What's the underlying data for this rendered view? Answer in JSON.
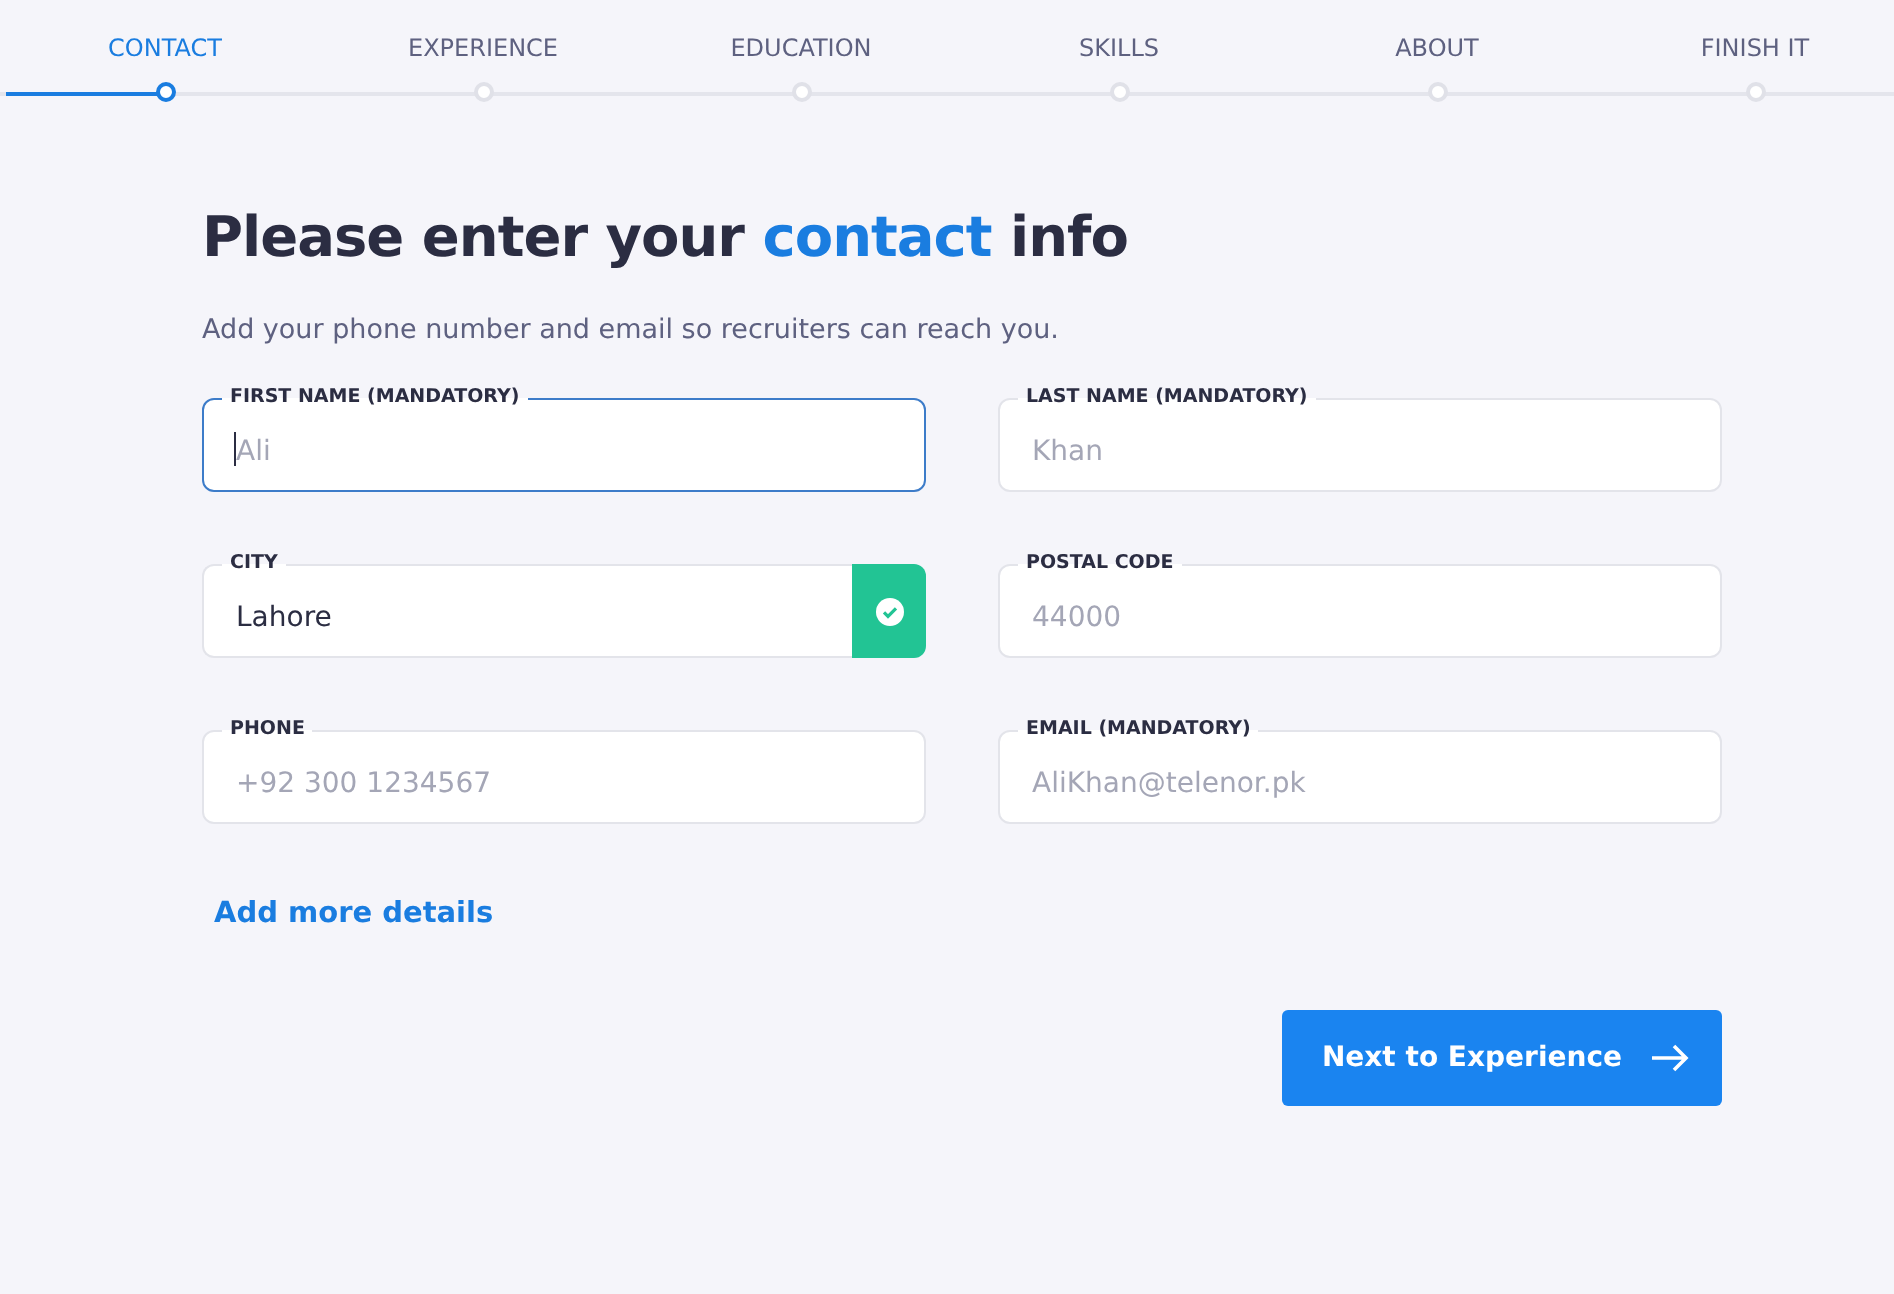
{
  "steps": [
    {
      "label": "CONTACT",
      "selected": true
    },
    {
      "label": "EXPERIENCE",
      "selected": false
    },
    {
      "label": "EDUCATION",
      "selected": false
    },
    {
      "label": "SKILLS",
      "selected": false
    },
    {
      "label": "ABOUT",
      "selected": false
    },
    {
      "label": "FINISH IT",
      "selected": false
    }
  ],
  "heading": {
    "before": "Please enter your ",
    "highlight": "contact",
    "after": " info"
  },
  "subtitle": "Add your phone number and email so recruiters can reach you.",
  "fields": [
    {
      "label": "FIRST NAME (MANDATORY)",
      "placeholder": "Ali",
      "focused": true,
      "valid": false
    },
    {
      "label": "LAST NAME (MANDATORY)",
      "placeholder": "Khan",
      "focused": false,
      "valid": false
    },
    {
      "label": "CITY",
      "value": "Lahore",
      "focused": false,
      "valid": true
    },
    {
      "label": "POSTAL CODE",
      "placeholder": "44000",
      "focused": false,
      "valid": false
    },
    {
      "label": "PHONE",
      "placeholder": "+92 300 1234567",
      "focused": false,
      "valid": false
    },
    {
      "label": "EMAIL (MANDATORY)",
      "placeholder": "AliKhan@telenor.pk",
      "focused": false,
      "valid": false
    }
  ],
  "more_link": "Add more details",
  "next_button": "Next to Experience"
}
